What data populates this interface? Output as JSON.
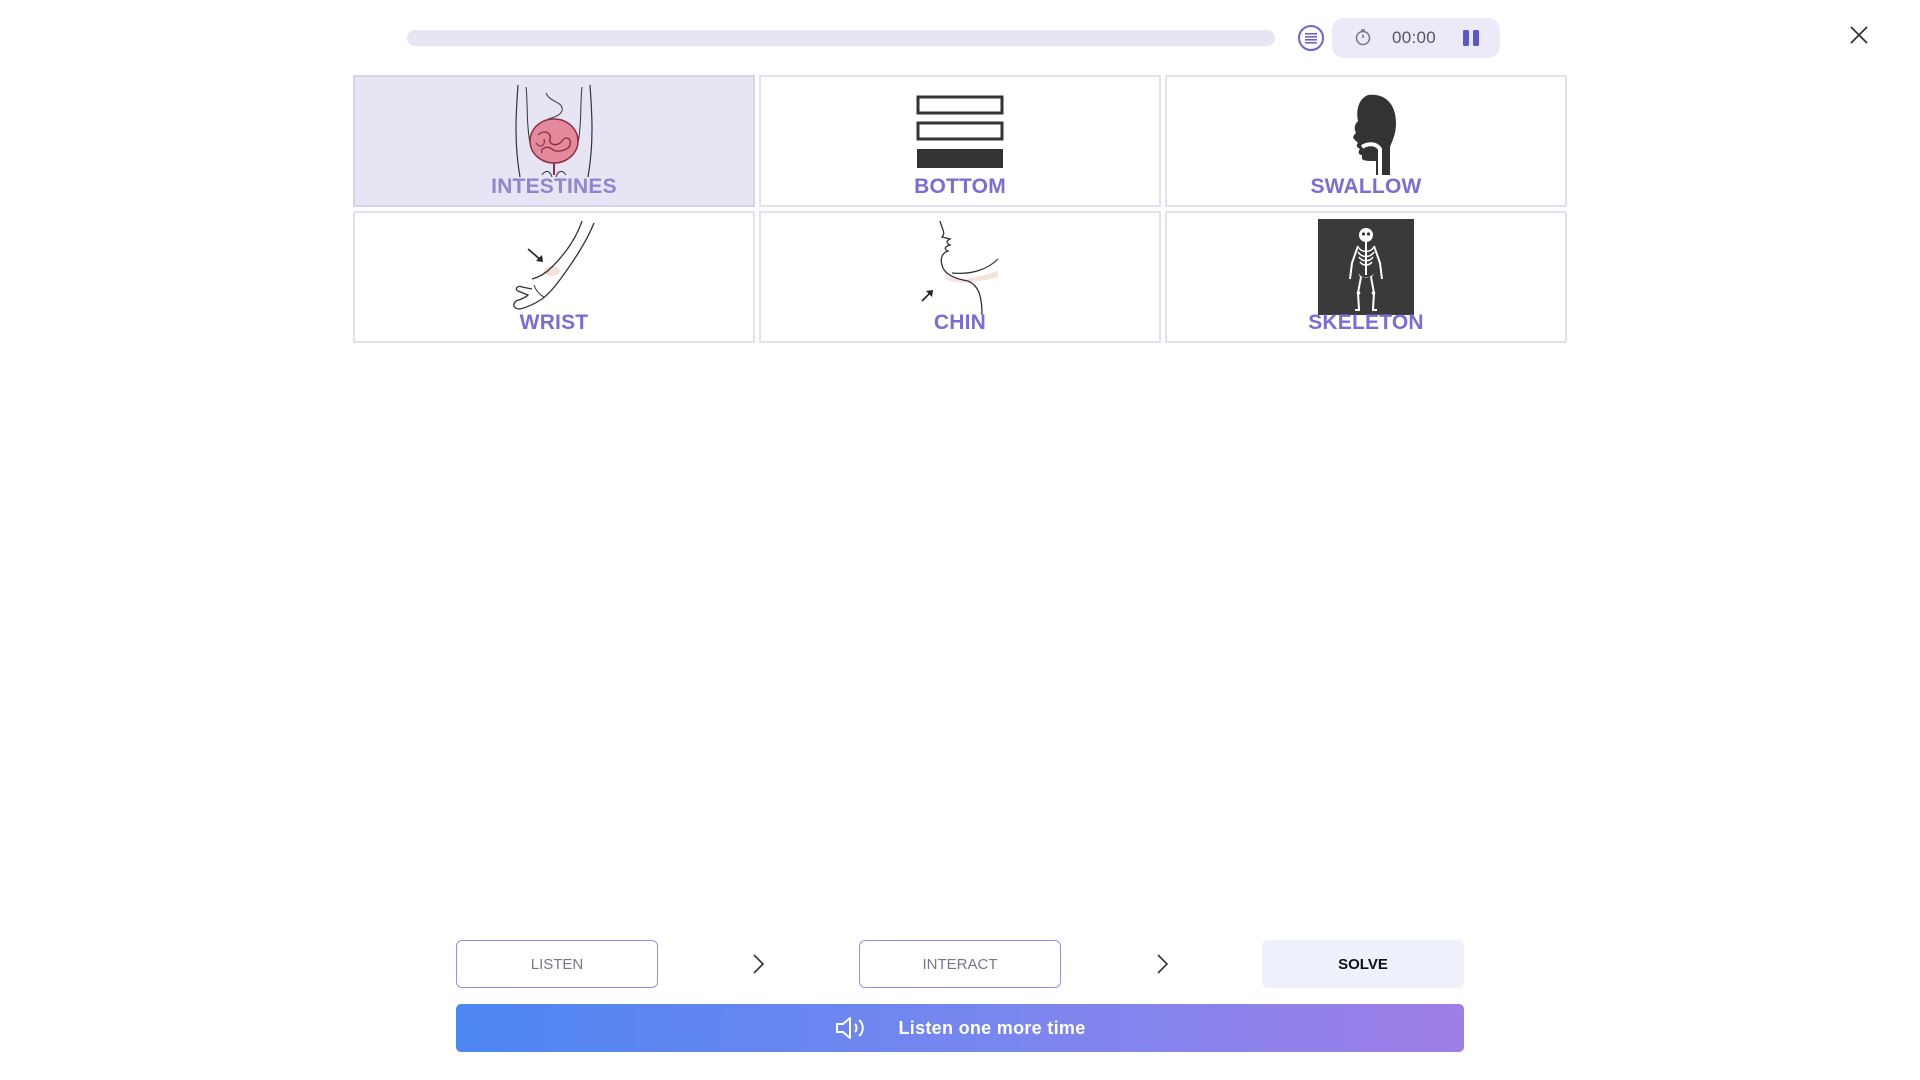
{
  "progress": {
    "fraction": 0
  },
  "timer": {
    "time": "00:00"
  },
  "cards": [
    {
      "label": "INTESTINES",
      "icon": "intestines-icon",
      "selected": true
    },
    {
      "label": "BOTTOM",
      "icon": "bottom-bars-icon",
      "selected": false
    },
    {
      "label": "SWALLOW",
      "icon": "swallow-head-icon",
      "selected": false
    },
    {
      "label": "WRIST",
      "icon": "wrist-icon",
      "selected": false
    },
    {
      "label": "CHIN",
      "icon": "chin-icon",
      "selected": false
    },
    {
      "label": "SKELETON",
      "icon": "skeleton-icon",
      "selected": false
    }
  ],
  "steps": {
    "listen": "LISTEN",
    "interact": "INTERACT",
    "solve": "SOLVE"
  },
  "listen_bar": {
    "label": "Listen one more time"
  },
  "colors": {
    "accent": "#7a6ed6",
    "selected_bg": "#e7e5f4",
    "gradient_start": "#4d86f2",
    "gradient_end": "#9f7ee8"
  }
}
